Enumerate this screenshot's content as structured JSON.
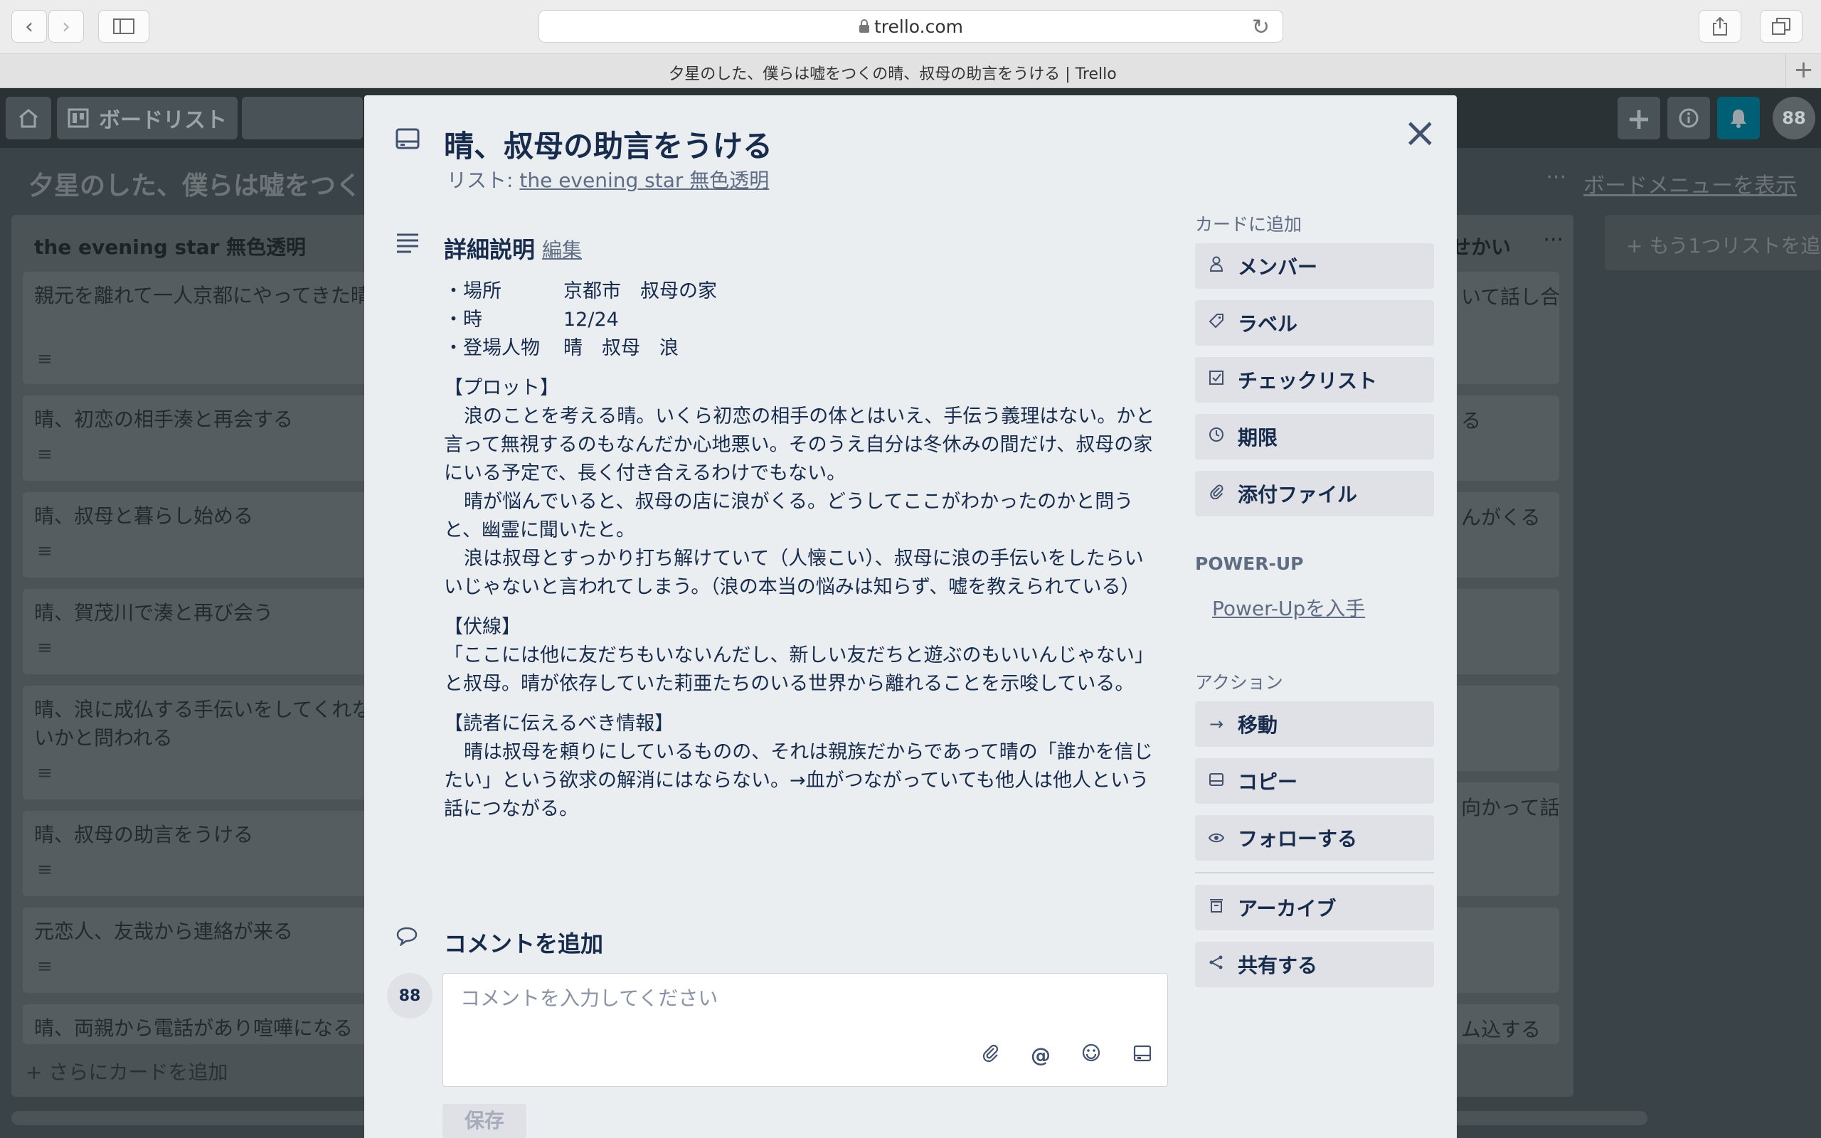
{
  "browser": {
    "url": "trello.com",
    "tab_title": "夕星のした、僕らは嘘をつくの晴、叔母の助言をうける | Trello",
    "new_tab": "+"
  },
  "board": {
    "boards_button": "ボードリスト",
    "title": "夕星のした、僕らは嘘をつく",
    "menu_label": "ボードメニューを表示",
    "menu_dots": "···",
    "user_initials": "88"
  },
  "left_list": {
    "title": "the evening star  無色透明",
    "cards": [
      "親元を離れて一人京都にやってきた晴",
      "晴、初恋の相手湊と再会する",
      "晴、叔母と暮らし始める",
      "晴、賀茂川で湊と再び会う",
      "晴、浪に成仏する手伝いをしてくれないかと問われる",
      "晴、叔母の助言をうける",
      "元恋人、友哉から連絡が来る",
      "晴、両親から電話があり喧嘩になる"
    ],
    "add_card": "+ さらにカードを追加"
  },
  "right_list": {
    "title": "せかい",
    "dots": "···",
    "card_fragments": [
      "いて話し合",
      "る",
      "んがくる",
      "",
      "",
      "向かって話",
      "",
      "ム込する"
    ]
  },
  "add_list": "+ もう1つリストを追加",
  "modal": {
    "title": "晴、叔母の助言をうける",
    "list_prefix": "リスト: ",
    "list_name": "the evening star 無色透明",
    "close": "×",
    "description": {
      "heading": "詳細説明",
      "edit": "編集",
      "meta": [
        {
          "label": "・場所",
          "value": "京都市　叔母の家"
        },
        {
          "label": "・時",
          "value": "12/24"
        },
        {
          "label": "・登場人物",
          "value": "晴　叔母　浪"
        }
      ],
      "plot_heading": "【プロット】",
      "plot_paragraphs": [
        "浪のことを考える晴。いくら初恋の相手の体とはいえ、手伝う義理はない。かと言って無視するのもなんだか心地悪い。そのうえ自分は冬休みの間だけ、叔母の家にいる予定で、長く付き合えるわけでもない。",
        "晴が悩んでいると、叔母の店に浪がくる。どうしてここがわかったのかと問うと、幽霊に聞いたと。",
        "浪は叔母とすっかり打ち解けていて（人懐こい）、叔母に浪の手伝いをしたらいいじゃないと言われてしまう。（浪の本当の悩みは知らず、嘘を教えられている）"
      ],
      "foreshadow_heading": "【伏線】",
      "foreshadow_text": "「ここには他に友だちもいないんだし、新しい友だちと遊ぶのもいいんじゃない」と叔母。晴が依存していた莉亜たちのいる世界から離れることを示唆している。",
      "reader_heading": "【読者に伝えるべき情報】",
      "reader_text": "晴は叔母を頼りにしているものの、それは親族だからであって晴の「誰かを信じたい」という欲求の解消にはならない。→血がつながっていても他人は他人という話につながる。"
    },
    "comment": {
      "heading": "コメントを追加",
      "avatar": "88",
      "placeholder": "コメントを入力してください",
      "save": "保存"
    },
    "sidebar": {
      "add_title": "カードに追加",
      "add_buttons": [
        {
          "icon": "member-icon",
          "label": "メンバー"
        },
        {
          "icon": "label-icon",
          "label": "ラベル"
        },
        {
          "icon": "checklist-icon",
          "label": "チェックリスト"
        },
        {
          "icon": "clock-icon",
          "label": "期限"
        },
        {
          "icon": "attachment-icon",
          "label": "添付ファイル"
        }
      ],
      "powerup_title": "POWER-UP",
      "powerup_link": "Power-Upを入手",
      "actions_title": "アクション",
      "action_buttons": [
        {
          "icon": "arrow-right-icon",
          "label": "移動"
        },
        {
          "icon": "card-icon",
          "label": "コピー"
        },
        {
          "icon": "eye-icon",
          "label": "フォローする"
        },
        {
          "icon": "archive-icon",
          "label": "アーカイブ"
        },
        {
          "icon": "share-icon",
          "label": "共有する"
        }
      ]
    }
  }
}
